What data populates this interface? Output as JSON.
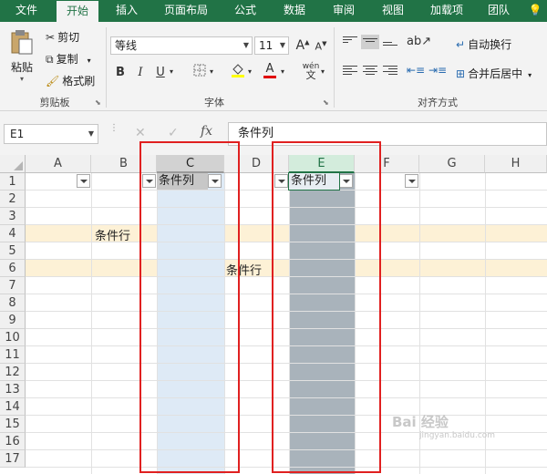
{
  "tabs": [
    "文件",
    "开始",
    "插入",
    "页面布局",
    "公式",
    "数据",
    "审阅",
    "视图",
    "加载项",
    "团队",
    "💡"
  ],
  "ribbon": {
    "clipboard": {
      "paste": "粘贴",
      "cut": "剪切",
      "copy": "复制",
      "format_painter": "格式刷",
      "label": "剪贴板"
    },
    "font": {
      "name": "等线",
      "size": "11",
      "grow": "A",
      "shrink": "A",
      "bold": "B",
      "italic": "I",
      "underline": "U",
      "font_color": "A",
      "phonetic": "wén",
      "label": "字体"
    },
    "alignment": {
      "wrap": "自动换行",
      "merge": "合并后居中",
      "label": "对齐方式"
    }
  },
  "formula_bar": {
    "name_box": "E1",
    "cancel": "✕",
    "enter": "✓",
    "fx": "fx",
    "value": "条件列"
  },
  "columns": [
    "A",
    "B",
    "C",
    "D",
    "E",
    "F",
    "G",
    "H"
  ],
  "rows": [
    "1",
    "2",
    "3",
    "4",
    "5",
    "6",
    "7",
    "8",
    "9",
    "10",
    "11",
    "12",
    "13",
    "14",
    "15",
    "16",
    "17"
  ],
  "cells": {
    "c1": "条件列",
    "e1": "条件列",
    "b4": "条件行",
    "d6": "条件行"
  },
  "colors": {
    "brand": "#217346",
    "row_band": "#fdf1d6",
    "column_c": "#deeaf6",
    "column_e": "#a9b3bb",
    "highlight_border": "#e02020"
  },
  "watermark": {
    "line1": "Bai 经验",
    "line2": "jingyan.baidu.com"
  }
}
